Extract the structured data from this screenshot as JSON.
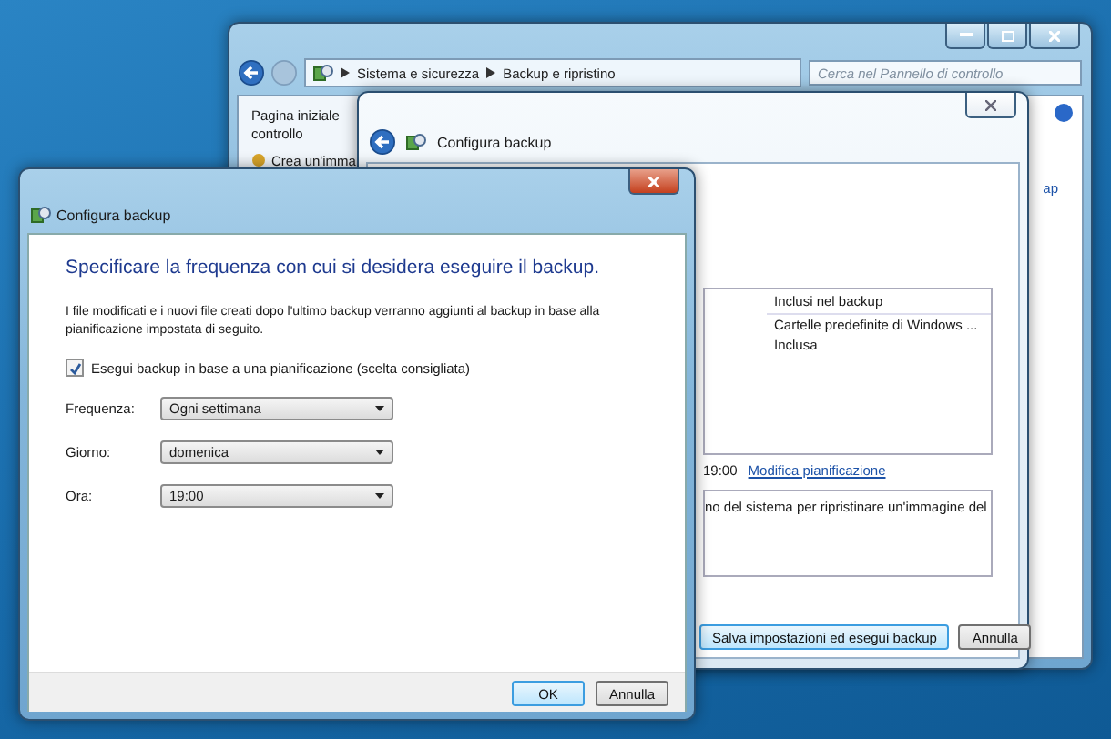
{
  "control_panel": {
    "breadcrumb": [
      "Sistema e sicurezza",
      "Backup e ripristino"
    ],
    "search": {
      "placeholder": "Cerca nel Pannello di controllo"
    },
    "sidebar_lines": [
      "Pagina iniziale",
      "controllo"
    ],
    "sidebar_link": "Crea un'imma",
    "right_link": "ap"
  },
  "wizard": {
    "title": "Configura backup",
    "table": {
      "column_2": "Inclusi nel backup",
      "cells": [
        "Cartelle predefinite di Windows ...",
        "Inclusa"
      ]
    },
    "schedule_time": "19:00",
    "schedule_link": "Modifica pianificazione",
    "note": "no del sistema per ripristinare un'immagine del",
    "buttons": [
      {
        "label": "Salva impostazioni ed esegui backup",
        "default": true
      },
      {
        "label": "Annulla",
        "default": false
      }
    ]
  },
  "dialog": {
    "title": "Configura backup",
    "heading": "Specificare la frequenza con cui si desidera eseguire il backup.",
    "description": "I file modificati e i nuovi file creati dopo l'ultimo backup verranno aggiunti al backup in base alla pianificazione impostata di seguito.",
    "schedule_checkbox": {
      "label": "Esegui backup in base a una pianificazione (scelta consigliata)",
      "checked": true
    },
    "fields": [
      {
        "label": "Frequenza:",
        "value": "Ogni settimana"
      },
      {
        "label": "Giorno:",
        "value": "domenica"
      },
      {
        "label": "Ora:",
        "value": "19:00"
      }
    ],
    "buttons": [
      {
        "label": "OK",
        "default": true
      },
      {
        "label": "Annulla",
        "default": false
      }
    ]
  }
}
